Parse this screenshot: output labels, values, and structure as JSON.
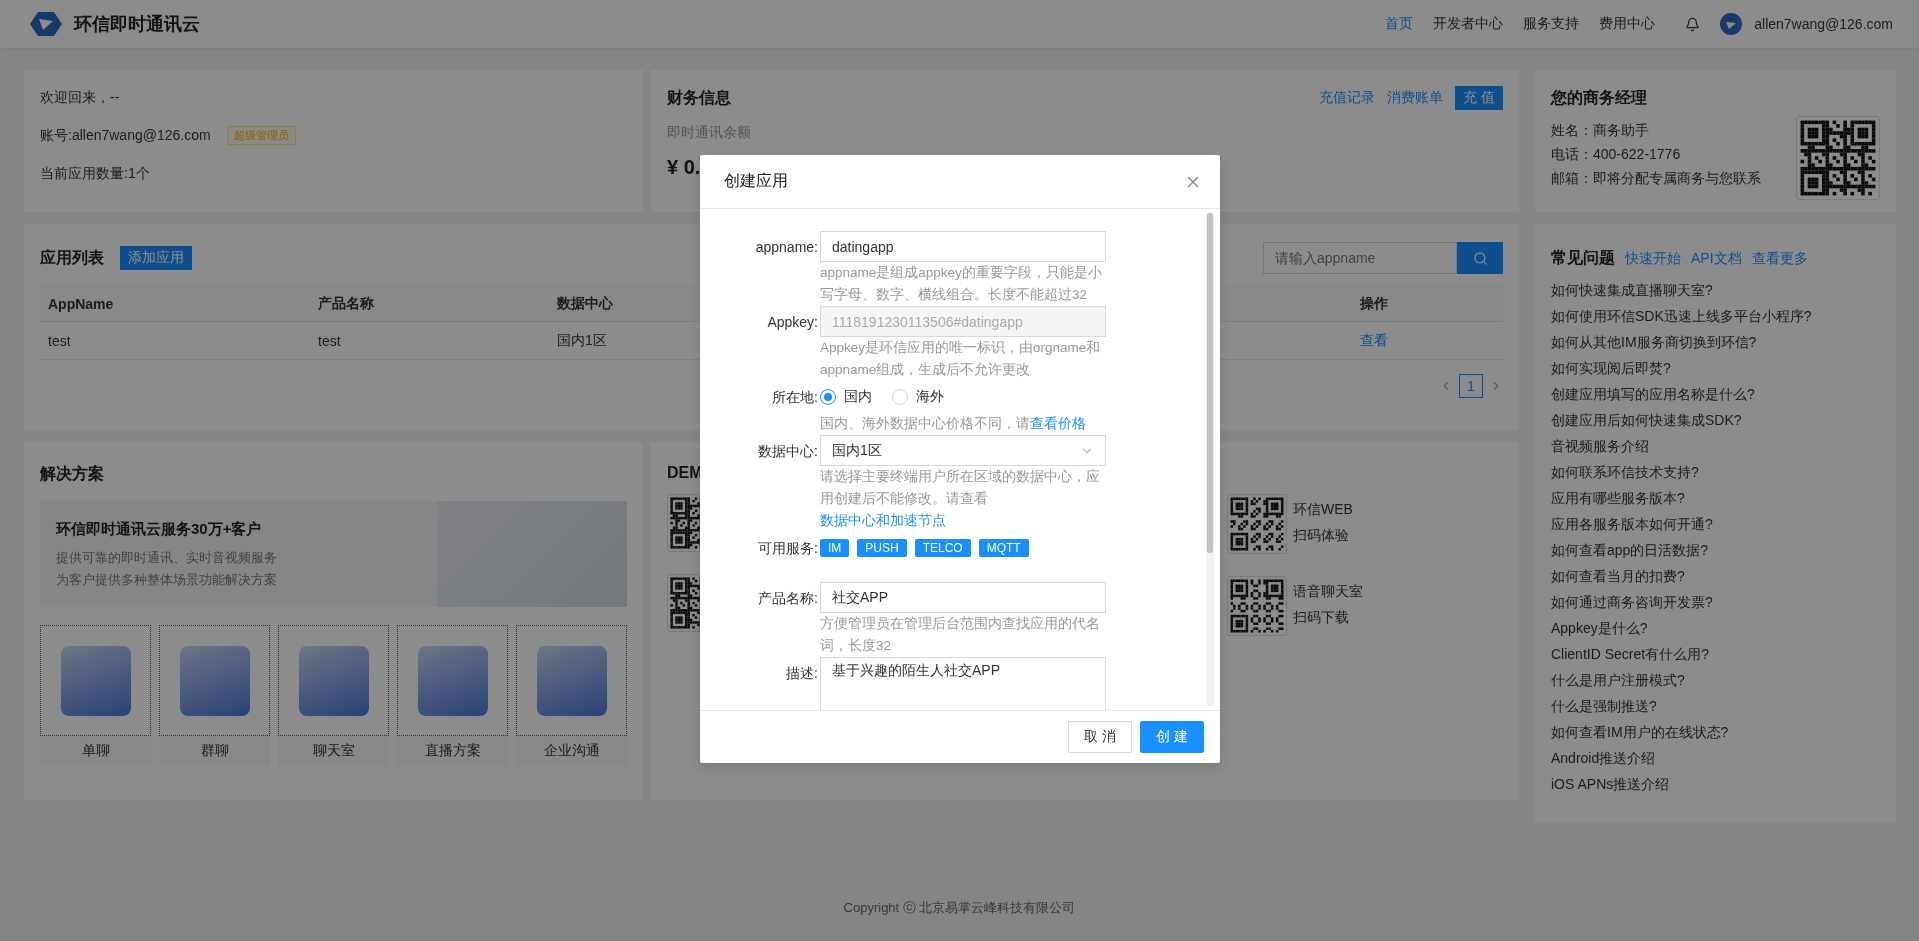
{
  "header": {
    "logo_text": "环信即时通讯云",
    "nav": [
      {
        "label": "首页",
        "selected": true
      },
      {
        "label": "开发者中心",
        "selected": false
      },
      {
        "label": "服务支持",
        "selected": false
      },
      {
        "label": "费用中心",
        "selected": false
      }
    ],
    "user_email": "allen7wang@126.com"
  },
  "welcome": {
    "greeting": "欢迎回来，--",
    "account": "账号:allen7wang@126.com",
    "role_badge": "超级管理员",
    "app_count": "当前应用数量:1个"
  },
  "finance": {
    "title": "财务信息",
    "links": [
      "充值记录",
      "消费账单"
    ],
    "recharge_button": "充 值",
    "balance_label": "即时通讯余额",
    "balance": "¥ 0."
  },
  "manager": {
    "title": "您的商务经理",
    "lines": [
      "姓名：商务助手",
      "电话：400-622-1776",
      "邮箱：即将分配专属商务与您联系"
    ]
  },
  "app_list": {
    "title": "应用列表",
    "add_button": "添加应用",
    "search_placeholder": "请输入appname",
    "columns": [
      "AppName",
      "产品名称",
      "数据中心",
      "操作"
    ],
    "rows": [
      [
        "test",
        "test",
        "国内1区",
        "查看"
      ]
    ],
    "pages": [
      {
        "label": "1",
        "selected": true
      }
    ]
  },
  "faq": {
    "title": "常见问题",
    "links": [
      "快速开始",
      "API文档",
      "查看更多"
    ],
    "items": [
      "如何快速集成直播聊天室?",
      "如何使用环信SDK迅速上线多平台小程序?",
      "如何从其他IM服务商切换到环信?",
      "如何实现阅后即焚?",
      "创建应用填写的应用名称是什么?",
      "创建应用后如何快速集成SDK?",
      "音视频服务介绍",
      "如何联系环信技术支持?",
      "应用有哪些服务版本?",
      "应用各服务版本如何开通?",
      "如何查看app的日活数据?",
      "如何查看当月的扣费?",
      "如何通过商务咨询开发票?",
      "Appkey是什么?",
      "ClientID Secret有什么用?",
      "什么是用户注册模式?",
      "什么是强制推送?",
      "如何查看IM用户的在线状态?",
      "Android推送介绍",
      "iOS APNs推送介绍"
    ]
  },
  "solutions": {
    "title": "解决方案",
    "banner": {
      "title": "环信即时通讯云服务30万+客户",
      "lines": [
        "提供可靠的即时通讯、实时音视频服务",
        "为客户提供多种整体场景功能解决方案"
      ]
    },
    "tiles": [
      "单聊",
      "群聊",
      "聊天室",
      "直播方案",
      "企业沟通"
    ]
  },
  "demo": {
    "title": "DEM",
    "items": [
      {
        "name": "环信WEB",
        "action": "扫码体验"
      },
      {
        "name": "语音聊天室",
        "action": "扫码下载"
      }
    ]
  },
  "footer": "Copyright ⓒ 北京易掌云峰科技有限公司",
  "modal": {
    "title": "创建应用",
    "fields": [
      {
        "kind": "input",
        "label": "appname:",
        "value": "datingapp",
        "disabled": false,
        "help": "appname是组成appkey的重要字段，只能是小写字母、数字、横线组合。长度不能超过32"
      },
      {
        "kind": "input",
        "label": "Appkey:",
        "value": "1118191230113506#datingapp",
        "disabled": true,
        "help": "Appkey是环信应用的唯一标识，由orgname和appname组成，生成后不允许更改"
      },
      {
        "kind": "radio",
        "label": "所在地:",
        "options": [
          {
            "label": "国内",
            "selected": true
          },
          {
            "label": "海外",
            "selected": false
          }
        ],
        "help": "国内、海外数据中心价格不同，请",
        "help_link": "查看价格"
      },
      {
        "kind": "select",
        "label": "数据中心:",
        "value": "国内1区",
        "help": "请选择主要终端用户所在区域的数据中心，应用创建后不能修改。请查看 ",
        "help_link": "数据中心和加速节点"
      },
      {
        "kind": "tags",
        "label": "可用服务:",
        "tags": [
          "IM",
          "PUSH",
          "TELCO",
          "MQTT"
        ]
      },
      {
        "kind": "input",
        "label": "产品名称:",
        "value": "社交APP",
        "disabled": false,
        "help": "方便管理员在管理后台范围内查找应用的代名词，长度32"
      },
      {
        "kind": "textarea",
        "label": "描述:",
        "value": "基于兴趣的陌生人社交APP"
      }
    ],
    "buttons": [
      {
        "label": "取 消",
        "primary": false
      },
      {
        "label": "创 建",
        "primary": true
      }
    ]
  }
}
